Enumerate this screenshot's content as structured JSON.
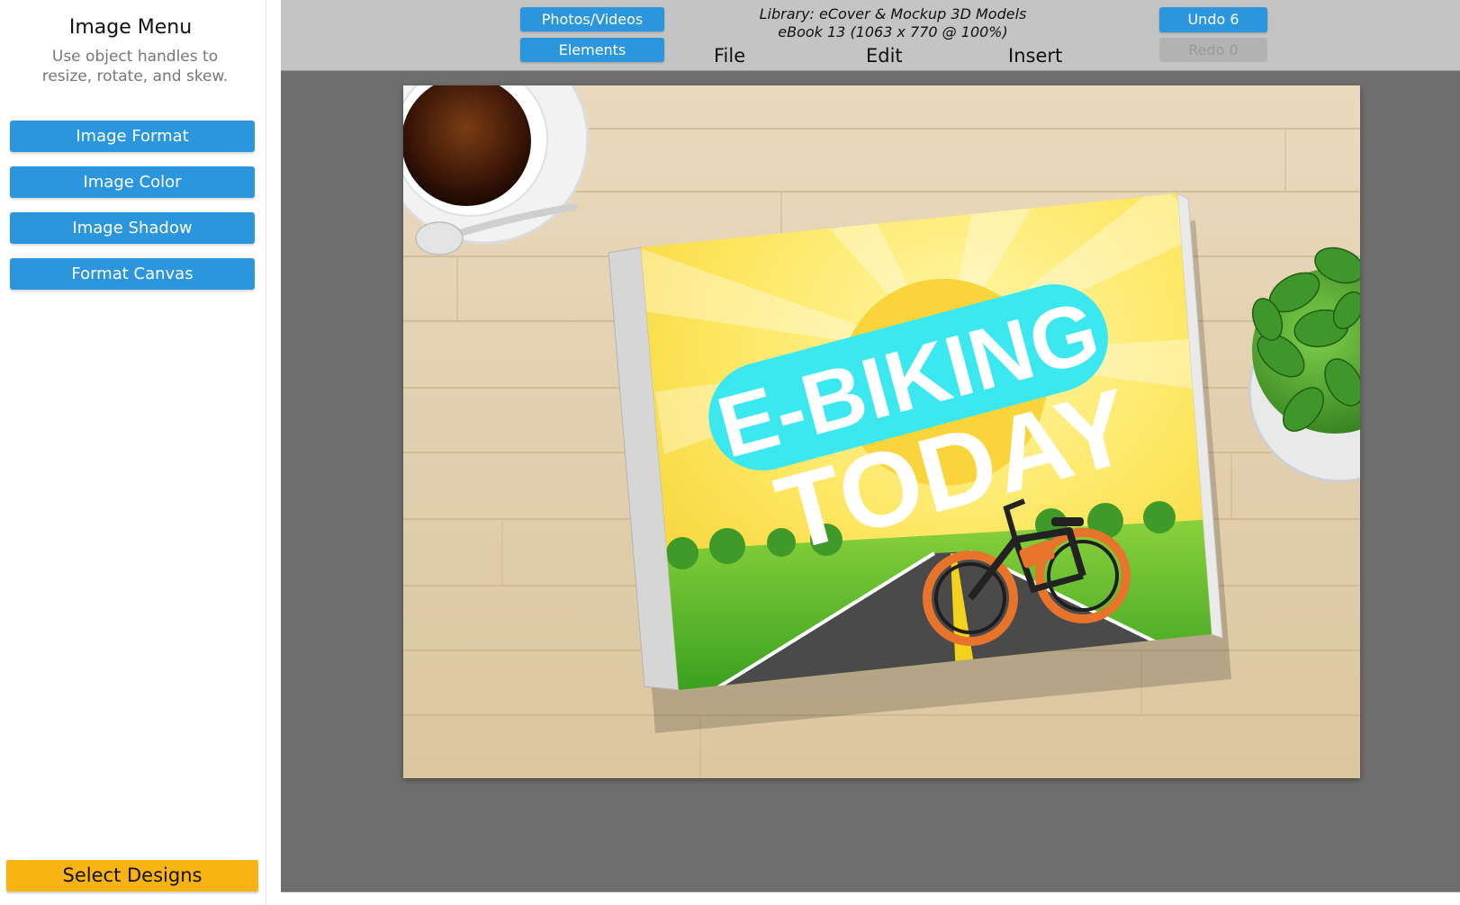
{
  "sidebar": {
    "title": "Image Menu",
    "description": "Use object handles to resize, rotate, and skew.",
    "buttons": [
      "Image Format",
      "Image Color",
      "Image Shadow",
      "Format Canvas"
    ],
    "select_designs": "Select Designs"
  },
  "header": {
    "photos_videos": "Photos/Videos",
    "elements": "Elements",
    "library_line1": "Library: eCover & Mockup 3D Models",
    "library_line2": "eBook 13 (1063 x 770 @ 100%)",
    "menu": {
      "file": "File",
      "edit": "Edit",
      "insert": "Insert"
    },
    "undo": "Undo 6",
    "redo": "Redo 0"
  },
  "canvas": {
    "cover_title_line1": "E-BIKING",
    "cover_title_line2": "TODAY"
  },
  "colors": {
    "button_blue": "#2b96dd",
    "select_yellow": "#f9b313",
    "header_gray": "#c4c4c4",
    "workspace_gray": "#6e6e6e",
    "title_pill": "#3ce8f0"
  }
}
